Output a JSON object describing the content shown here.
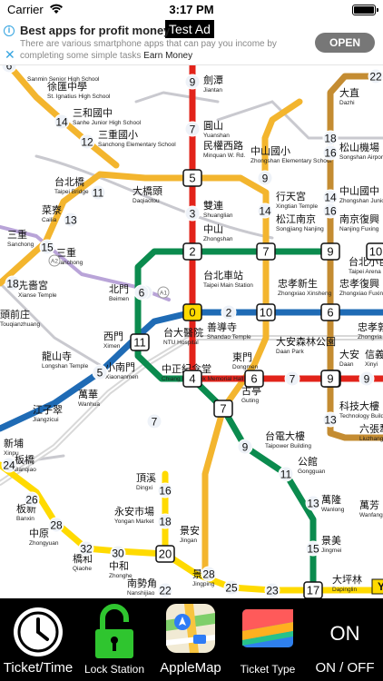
{
  "status_bar": {
    "carrier": "Carrier",
    "time": "3:17 PM"
  },
  "ad": {
    "badge": "Test Ad",
    "title": "Best apps for profit money",
    "body": "There are various smartphone apps that can pay you income by completing some simple tasks",
    "advertiser": "Earn Money",
    "cta": "OPEN",
    "info_glyph": "i",
    "close_glyph": "✕"
  },
  "map": {
    "colors": {
      "blue": "#1f6bb5",
      "orange": "#f3b52e",
      "green": "#0b8b4e",
      "red": "#e2231a",
      "brown": "#c48c32",
      "yellow": "#ffda00",
      "gray": "#c9c9cf"
    },
    "labels": [
      {
        "zh": "劍潭",
        "en": "Jiantan"
      },
      {
        "zh": "圓山",
        "en": "Yuanshan"
      },
      {
        "zh": "民權西路",
        "en": "Minquan W. Rd."
      },
      {
        "zh": "雙連",
        "en": "Shuanglian"
      },
      {
        "zh": "中山",
        "en": "Zhongshan"
      },
      {
        "zh": "台北車站",
        "en": "Taipei Main Station"
      },
      {
        "zh": "徐匯中學",
        "en": "St. Ignatius High School"
      },
      {
        "zh": "三和國中",
        "en": "Sanhe Junior High School"
      },
      {
        "zh": "三重國小",
        "en": "Sanchong Elementary School"
      },
      {
        "zh": "",
        "en": "Sanmin Senior High School"
      },
      {
        "zh": "台北橋",
        "en": "Taipei Bridge"
      },
      {
        "zh": "大橋頭",
        "en": "Daqiaotou"
      },
      {
        "zh": "菜寮",
        "en": "Cailia"
      },
      {
        "zh": "三重",
        "en": "Sanchong"
      },
      {
        "zh": "三重",
        "en": "Sanchong"
      },
      {
        "zh": "先嗇宮",
        "en": "Xianse Temple"
      },
      {
        "zh": "頭前庄",
        "en": "Touqianzhuang"
      },
      {
        "zh": "北門",
        "en": "Beimen"
      },
      {
        "zh": "西門",
        "en": "Ximen"
      },
      {
        "zh": "龍山寺",
        "en": "Longshan Temple"
      },
      {
        "zh": "江子翠",
        "en": "Jiangzicui"
      },
      {
        "zh": "新埔",
        "en": "Xinpu"
      },
      {
        "zh": "板橋",
        "en": "Banqiao"
      },
      {
        "zh": "萬華",
        "en": "Wanhua"
      },
      {
        "zh": "台大醫院",
        "en": "NTU Hospital"
      },
      {
        "zh": "善導寺",
        "en": "Shandao Temple"
      },
      {
        "zh": "小南門",
        "en": "Xiaonanmen"
      },
      {
        "zh": "中正紀念堂",
        "en": "Chiang Kai-Shek Memorial Hall"
      },
      {
        "zh": "東門",
        "en": "Dongmen"
      },
      {
        "zh": "古亭",
        "en": "Guting"
      },
      {
        "zh": "大安森林公園",
        "en": "Daan Park"
      },
      {
        "zh": "大安",
        "en": "Daan"
      },
      {
        "zh": "忠孝新生",
        "en": "Zhongxiao Xinsheng"
      },
      {
        "zh": "忠孝復興",
        "en": "Zhongxiao Fuxing"
      },
      {
        "zh": "忠孝敦",
        "en": "Zhongxia"
      },
      {
        "zh": "信義",
        "en": "Xinyi"
      },
      {
        "zh": "科技大樓",
        "en": "Technology Building"
      },
      {
        "zh": "六張犁",
        "en": "Liuzhang"
      },
      {
        "zh": "中山國小",
        "en": "Zhongshan Elementary School"
      },
      {
        "zh": "行天宮",
        "en": "Xingtian Temple"
      },
      {
        "zh": "松江南京",
        "en": "Songjiang Nanjing"
      },
      {
        "zh": "南京復興",
        "en": "Nanjing Fuxing"
      },
      {
        "zh": "台北小巨蛋",
        "en": "Taipei Arena"
      },
      {
        "zh": "大直",
        "en": "Dazhi"
      },
      {
        "zh": "松山機場",
        "en": "Songshan Airport"
      },
      {
        "zh": "中山國中",
        "en": "Zhongshan Junior High School"
      },
      {
        "zh": "台電大樓",
        "en": "Taipower Building"
      },
      {
        "zh": "公館",
        "en": "Gongguan"
      },
      {
        "zh": "萬隆",
        "en": "Wanlong"
      },
      {
        "zh": "景美",
        "en": "Jingmei"
      },
      {
        "zh": "萬芳",
        "en": "Wanfang"
      },
      {
        "zh": "大坪林",
        "en": "Dapinglin"
      },
      {
        "zh": "頂溪",
        "en": "Dingxi"
      },
      {
        "zh": "永安市場",
        "en": "Yongan Market"
      },
      {
        "zh": "景安",
        "en": "Jingan"
      },
      {
        "zh": "景平",
        "en": "Jingping"
      },
      {
        "zh": "南勢角",
        "en": "Nanshijiao"
      },
      {
        "zh": "板新",
        "en": "Banxin"
      },
      {
        "zh": "中原",
        "en": "Zhongyuan"
      },
      {
        "zh": "橋和",
        "en": "Qiaohe"
      },
      {
        "zh": "中和",
        "en": "Zhonghe"
      }
    ],
    "badges": [
      "9",
      "7",
      "5",
      "3",
      "2",
      "0",
      "2",
      "4",
      "6",
      "7",
      "9",
      "9",
      "10",
      "13",
      "16",
      "18",
      "14",
      "12",
      "11",
      "13",
      "15",
      "18",
      "5",
      "7",
      "9",
      "10",
      "11",
      "13",
      "15",
      "17",
      "16",
      "18",
      "20",
      "22",
      "22",
      "23",
      "25",
      "26",
      "28",
      "30",
      "32",
      "28",
      "24",
      "6",
      "9",
      "14",
      "16",
      "20",
      "22",
      "6",
      "7",
      "11",
      "13",
      "16",
      "2",
      "3"
    ],
    "line_codes": [
      "A1",
      "A2"
    ],
    "cutoff_badge": "Y"
  },
  "toolbar": {
    "items": [
      {
        "label": "Ticket/Time"
      },
      {
        "label": "Lock Station"
      },
      {
        "label": "AppleMap"
      },
      {
        "label": "Ticket Type"
      },
      {
        "label": "ON / OFF"
      }
    ],
    "on_off_state": "ON"
  }
}
